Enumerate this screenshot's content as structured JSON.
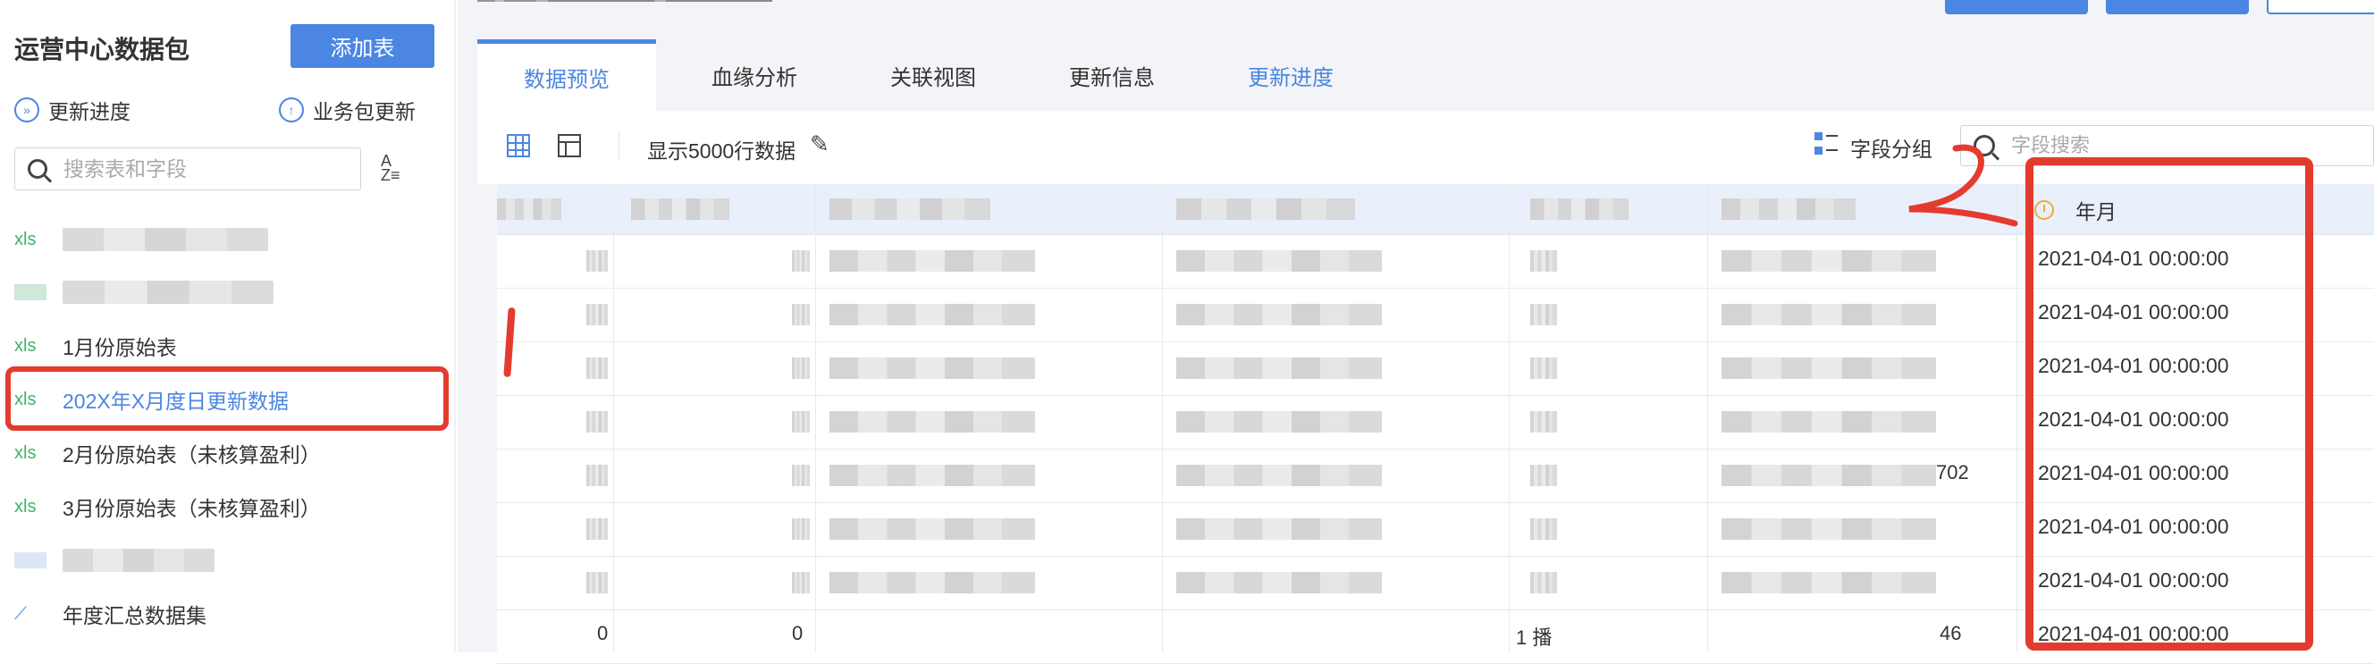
{
  "sidebar": {
    "title": "运营中心数据包",
    "add_button": "添加表",
    "update_progress": "更新进度",
    "pkg_update": "业务包更新",
    "search_placeholder": "搜索表和字段",
    "items": [
      {
        "icon": "xls",
        "label": ""
      },
      {
        "icon": "table",
        "label": ""
      },
      {
        "icon": "xls",
        "label": "1月份原始表"
      },
      {
        "icon": "xls",
        "label": "202X年X月度日更新数据",
        "active": true
      },
      {
        "icon": "xls",
        "label": "2月份原始表（未核算盈利）"
      },
      {
        "icon": "xls",
        "label": "3月份原始表（未核算盈利）"
      },
      {
        "icon": "dataset",
        "label": ""
      },
      {
        "icon": "trend",
        "label": "年度汇总数据集"
      }
    ]
  },
  "tabs": [
    "数据预览",
    "血缘分析",
    "关联视图",
    "更新信息",
    "更新进度"
  ],
  "toolbar": {
    "row_limit": "显示5000行数据",
    "field_group": "字段分组",
    "field_search_placeholder": "字段搜索"
  },
  "table": {
    "visible_header": "年月",
    "year_month_values": [
      "2021-04-01 00:00:00",
      "2021-04-01 00:00:00",
      "2021-04-01 00:00:00",
      "2021-04-01 00:00:00",
      "2021-04-01 00:00:00",
      "2021-04-01 00:00:00",
      "2021-04-01 00:00:00",
      "2021-04-01 00:00:00"
    ],
    "fragments": {
      "r4_col6_tail": "702",
      "r7_col1": "0",
      "r7_col2": "0",
      "r7_col6_tail": "46",
      "r7_col5": "1 播"
    }
  },
  "annotations": {
    "mark1": "1",
    "mark2": "2",
    "color": "#e33b2e"
  },
  "colors": {
    "accent": "#4b86e3",
    "xls": "#3fb26c",
    "header_bg": "#e9f0fb"
  }
}
